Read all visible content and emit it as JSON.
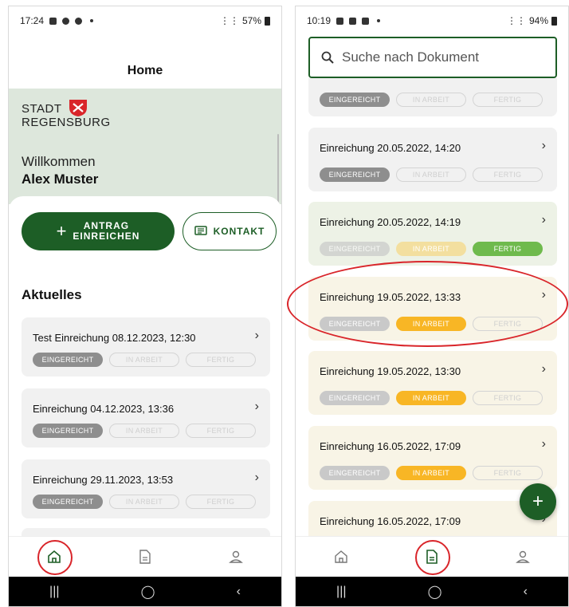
{
  "left": {
    "status": {
      "time": "17:24",
      "battery": "57%"
    },
    "title": "Home",
    "logo": {
      "line1": "STADT",
      "line2": "REGENSBURG"
    },
    "welcome": "Willkommen",
    "user": "Alex Muster",
    "btn_antrag": {
      "line1": "ANTRAG",
      "line2": "EINREICHEN"
    },
    "btn_kontakt": "KONTAKT",
    "section": "Aktuelles",
    "cards": [
      {
        "title": "Test Einreichung 08.12.2023, 12:30"
      },
      {
        "title": "Einreichung 04.12.2023, 13:36"
      },
      {
        "title": "Einreichung 29.11.2023, 13:53"
      }
    ],
    "chips": {
      "c1": "EINGEREICHT",
      "c2": "IN ARBEIT",
      "c3": "FERTIG"
    }
  },
  "right": {
    "status": {
      "time": "10:19",
      "battery": "94%"
    },
    "search_placeholder": "Suche nach Dokument",
    "cards": [
      {
        "title": ""
      },
      {
        "title": "Einreichung 20.05.2022, 14:20"
      },
      {
        "title": "Einreichung 20.05.2022, 14:19"
      },
      {
        "title": "Einreichung 19.05.2022, 13:33"
      },
      {
        "title": "Einreichung 19.05.2022, 13:30"
      },
      {
        "title": "Einreichung 16.05.2022, 17:09"
      },
      {
        "title": "Einreichung 16.05.2022, 17:09"
      }
    ],
    "chips": {
      "c1": "EINGEREICHT",
      "c2": "IN ARBEIT",
      "c3": "FERTIG"
    }
  },
  "colors": {
    "primary": "#1d5e26",
    "hero_bg": "#dde7dc",
    "highlight_red": "#d9252a",
    "status_grey": "#8e8e8e",
    "status_green": "#6fba4d",
    "status_yellow": "#f8b625"
  }
}
